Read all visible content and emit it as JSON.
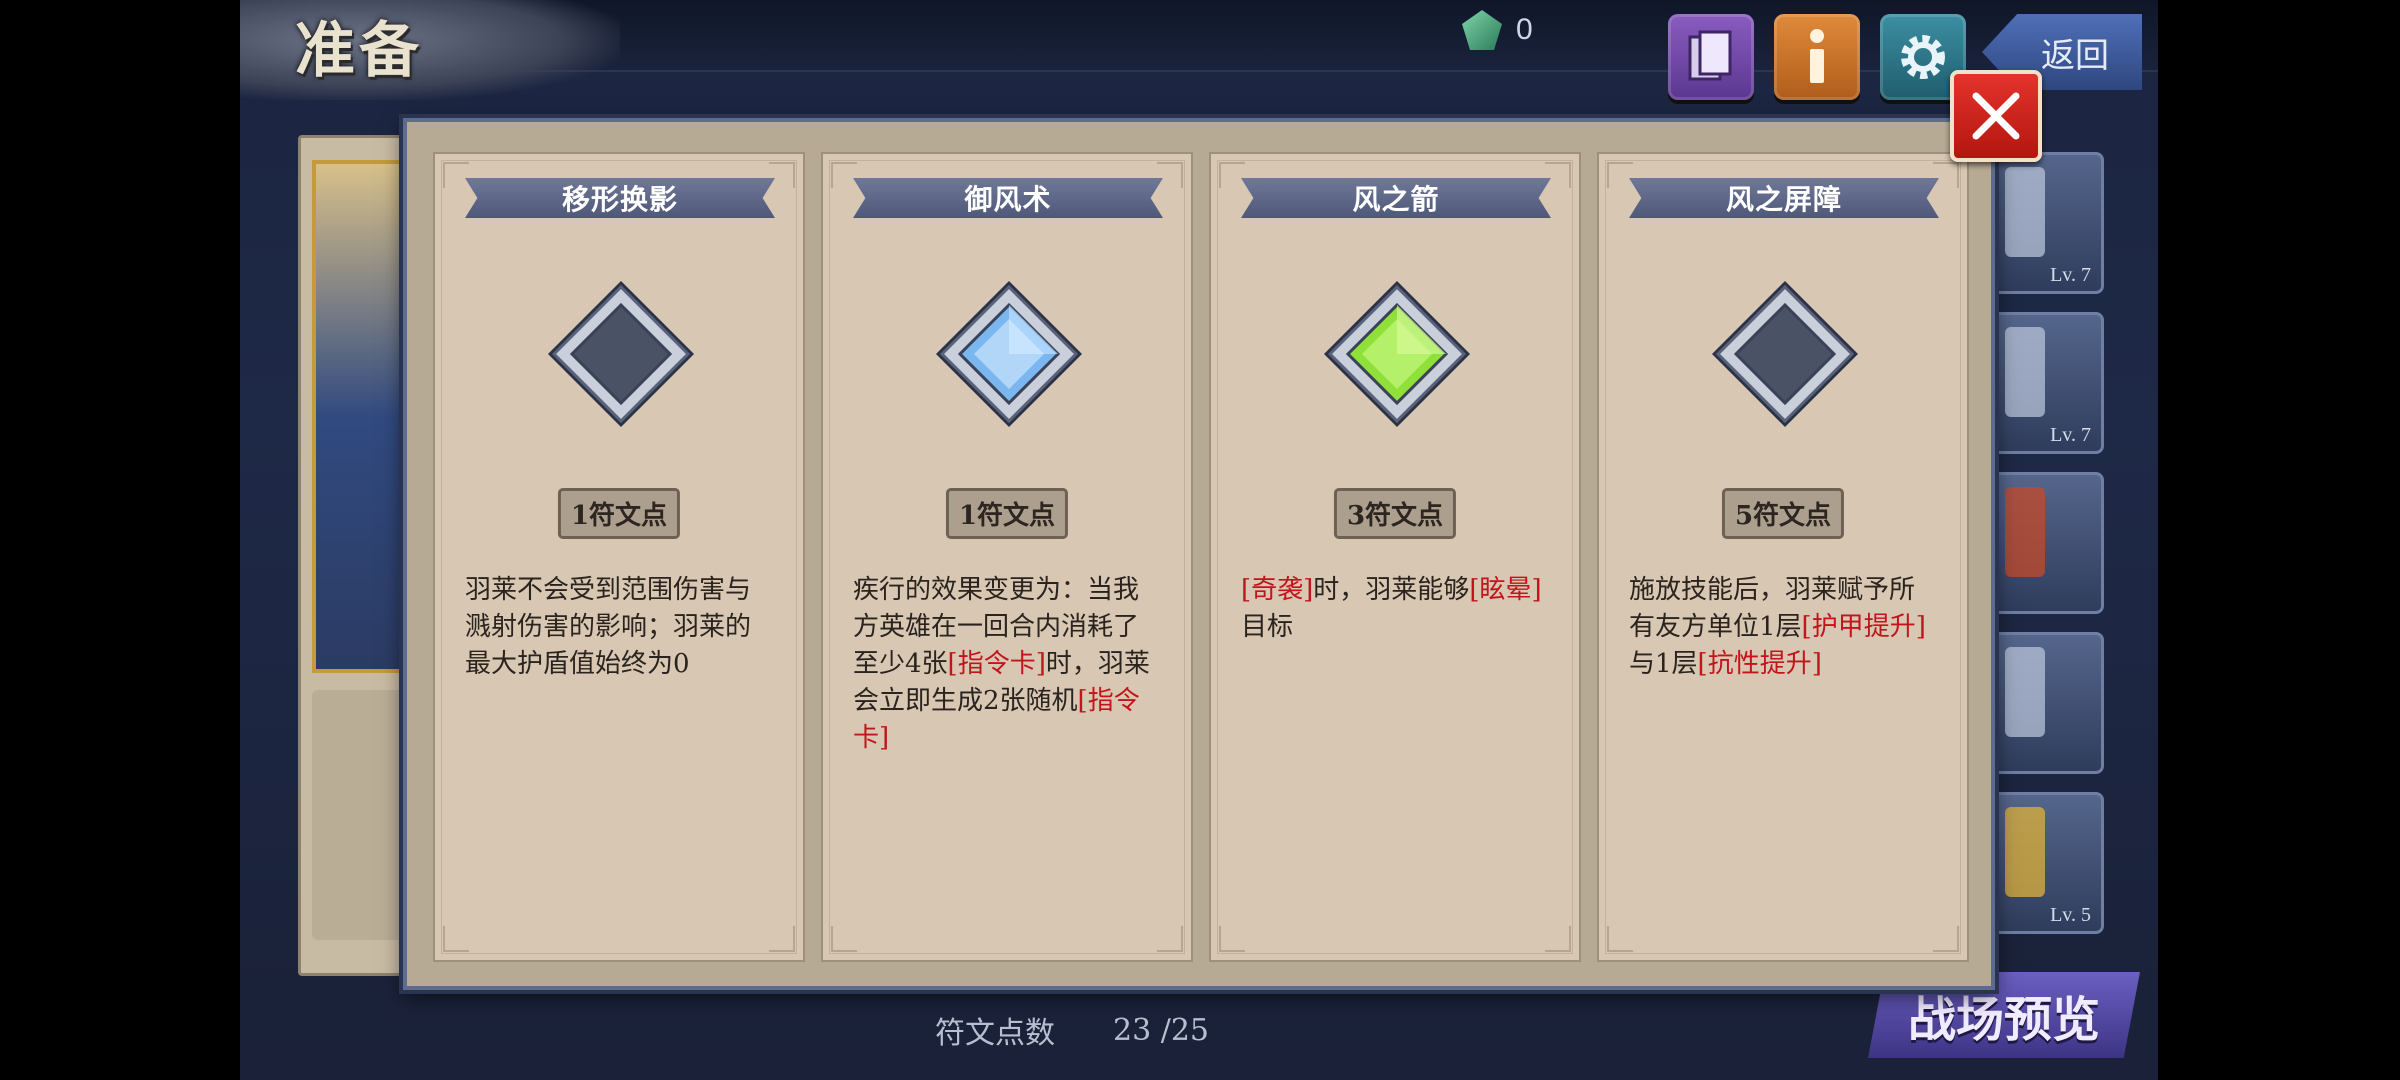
{
  "header": {
    "title": "准备",
    "gem_count": "0",
    "back_label": "返回"
  },
  "modal": {
    "cards": [
      {
        "name": "移形换影",
        "cost": "1符文点",
        "gem_state": "empty",
        "desc": [
          {
            "t": "羽莱不会受到范围伤害与溅射伤害的影响；羽莱的最大护盾值始终为0",
            "hl": false
          }
        ]
      },
      {
        "name": "御风术",
        "cost": "1符文点",
        "gem_state": "blue",
        "desc": [
          {
            "t": "疾行的效果变更为：当我方英雄在一回合内消耗了至少4张",
            "hl": false
          },
          {
            "t": "[指令卡]",
            "hl": true
          },
          {
            "t": "时，羽莱会立即生成2张随机",
            "hl": false
          },
          {
            "t": "[指令卡]",
            "hl": true
          }
        ]
      },
      {
        "name": "风之箭",
        "cost": "3符文点",
        "gem_state": "green",
        "desc": [
          {
            "t": "[奇袭]",
            "hl": true
          },
          {
            "t": "时，羽莱能够",
            "hl": false
          },
          {
            "t": "[眩晕]",
            "hl": true
          },
          {
            "t": "目标",
            "hl": false
          }
        ]
      },
      {
        "name": "风之屏障",
        "cost": "5符文点",
        "gem_state": "empty",
        "desc": [
          {
            "t": "施放技能后，羽莱赋予所有友方单位1层",
            "hl": false
          },
          {
            "t": "[护甲提升]",
            "hl": true
          },
          {
            "t": "与1层",
            "hl": false
          },
          {
            "t": "[抗性提升]",
            "hl": true
          }
        ]
      }
    ]
  },
  "right_slots": [
    {
      "lv": "Lv. 7"
    },
    {
      "lv": "Lv. 7"
    },
    {
      "lv": ""
    },
    {
      "lv": ""
    },
    {
      "lv": "Lv. 5"
    }
  ],
  "footer": {
    "rune_label": "符文点数",
    "rune_value": "23 /25",
    "battle_label": "战场预览"
  },
  "colors": {
    "highlight": "#c4141b",
    "blue_gem": "#7ab6f0",
    "green_gem": "#8fe03a",
    "empty_gem": "#4a5366"
  }
}
